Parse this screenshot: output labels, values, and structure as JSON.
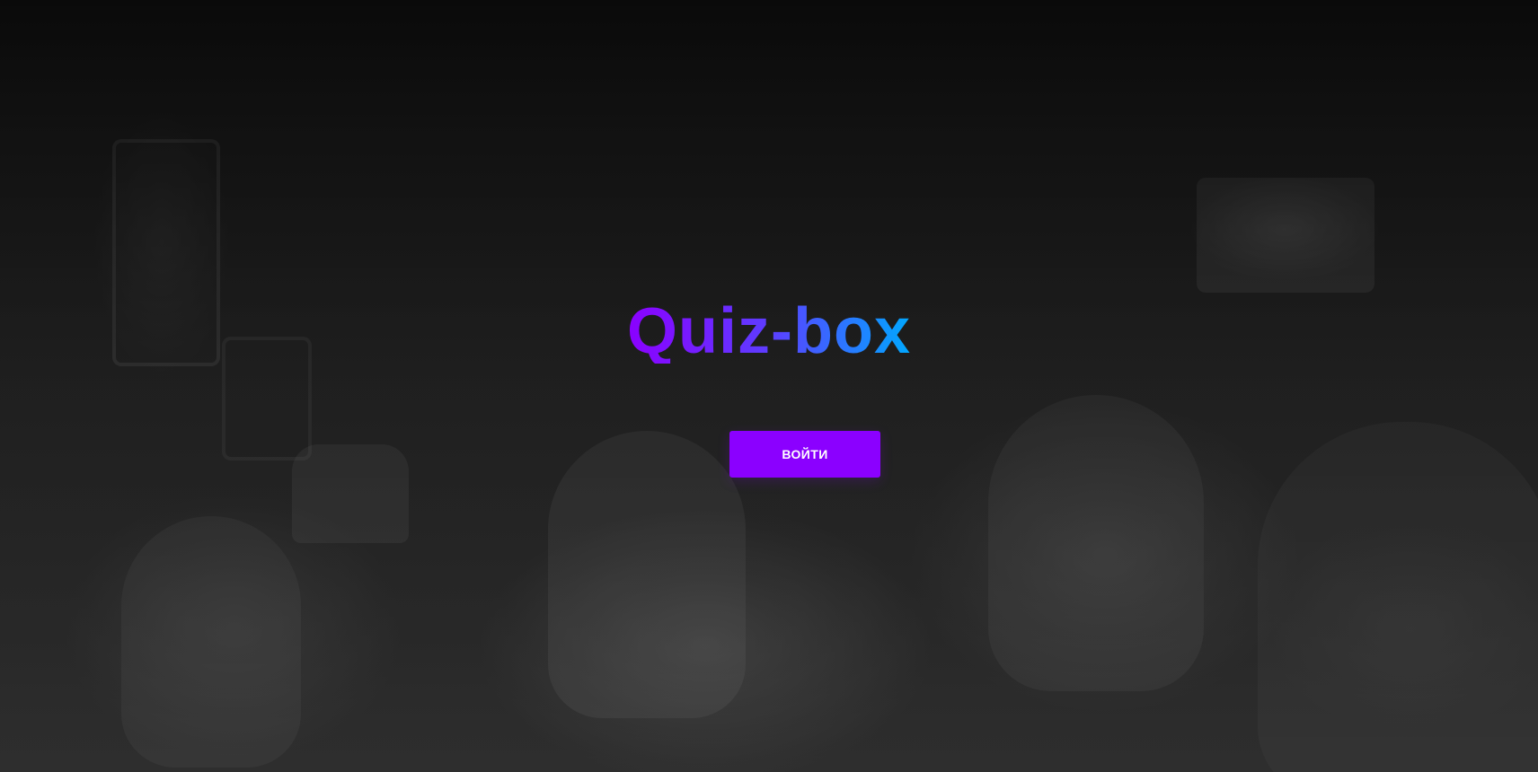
{
  "hero": {
    "title": "Quiz-box",
    "login_label": "ВОЙТИ",
    "accent_color": "#8b00ff",
    "gradient_colors": [
      "#8b00ff",
      "#5d3dff",
      "#00a8ff"
    ]
  }
}
